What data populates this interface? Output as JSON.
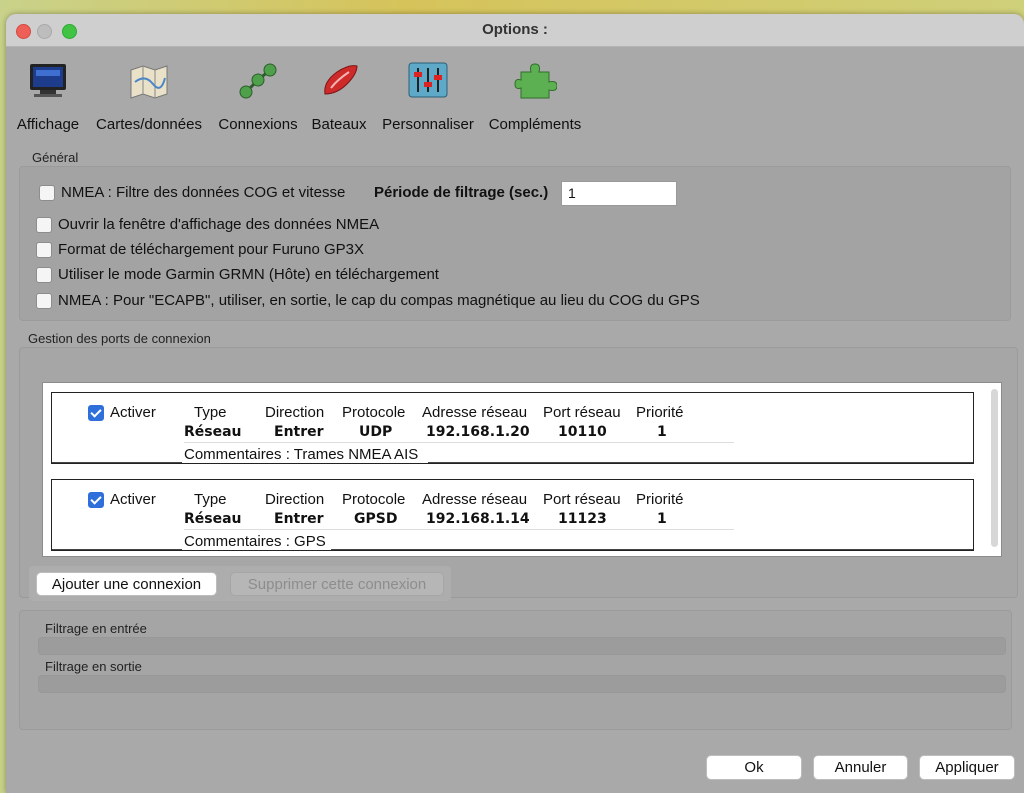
{
  "window": {
    "title": "Options :"
  },
  "toolbar": {
    "items": [
      {
        "label": "Affichage",
        "icon": "monitor-icon",
        "active": false
      },
      {
        "label": "Cartes/données",
        "icon": "charts-icon",
        "active": false
      },
      {
        "label": "Connexions",
        "icon": "connections-icon",
        "active": true
      },
      {
        "label": "Bateaux",
        "icon": "boat-icon",
        "active": false
      },
      {
        "label": "Personnaliser",
        "icon": "sliders-icon",
        "active": false
      },
      {
        "label": "Compléments",
        "icon": "puzzle-icon",
        "active": false
      }
    ]
  },
  "general": {
    "title": "Général",
    "nmea_filter_label": "NMEA : Filtre des données COG et vitesse",
    "filter_period_label": "Période de filtrage (sec.)",
    "filter_period_value": "1",
    "options": [
      "Ouvrir la fenêtre d'affichage des données NMEA",
      "Format de téléchargement pour Furuno GP3X",
      "Utiliser le mode Garmin GRMN (Hôte) en téléchargement",
      "NMEA : Pour \"ECAPB\", utiliser, en sortie, le cap du compas magnétique  au lieu du COG du GPS"
    ]
  },
  "ports": {
    "title": "Gestion des ports de connexion",
    "headers": {
      "activer": "Activer",
      "type": "Type",
      "direction": "Direction",
      "protocol": "Protocole",
      "address": "Adresse réseau",
      "port": "Port réseau",
      "priority": "Priorité"
    },
    "connections": [
      {
        "type": "Réseau",
        "direction": "Entrer",
        "protocol": "UDP",
        "address": "192.168.1.20",
        "port": "10110",
        "priority": "1",
        "comment": "Commentaires : Trames NMEA AIS"
      },
      {
        "type": "Réseau",
        "direction": "Entrer",
        "protocol": "GPSD",
        "address": "192.168.1.14",
        "port": "11123",
        "priority": "1",
        "comment": "Commentaires : GPS"
      }
    ],
    "add_button": "Ajouter une connexion",
    "remove_button": "Supprimer cette connexion"
  },
  "filtering": {
    "input_label": "Filtrage en entrée",
    "output_label": "Filtrage en sortie"
  },
  "footer": {
    "ok": "Ok",
    "cancel": "Annuler",
    "apply": "Appliquer"
  }
}
